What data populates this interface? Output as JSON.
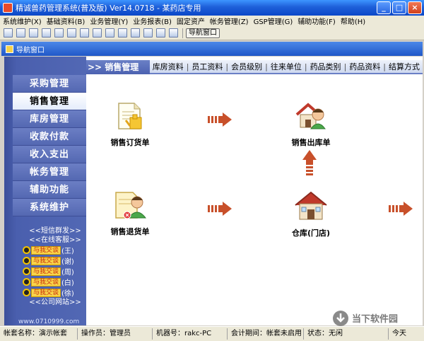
{
  "window": {
    "title": "精诚兽药管理系统(普及版) Ver14.0718 - 某药店专用"
  },
  "menu": [
    "系统维护(X)",
    "基础资料(B)",
    "业务管理(Y)",
    "业务报表(B)",
    "固定资产",
    "帐务管理(Z)",
    "GSP管理(G)",
    "辅助功能(F)",
    "帮助(H)"
  ],
  "toolbar": {
    "nav_window_label": "导航窗口"
  },
  "child_window": {
    "caption": "导航窗口"
  },
  "sidebar": {
    "items": [
      {
        "label": "采购管理"
      },
      {
        "label": "销售管理"
      },
      {
        "label": "库房管理"
      },
      {
        "label": "收款付款"
      },
      {
        "label": "收入支出"
      },
      {
        "label": "帐务管理"
      },
      {
        "label": "辅助功能"
      },
      {
        "label": "系统维护"
      }
    ],
    "sms_link": "<<短信群发>>",
    "service_link": "<<在线客服>>",
    "qq_button": "与我交谈",
    "qq_contacts": [
      "(王)",
      "(谢)",
      "(周)",
      "(白)",
      "(徐)"
    ],
    "company_link": "<<公司网站>>",
    "site": "www.0710999.com"
  },
  "content": {
    "header": ">> 销售管理",
    "tabs": [
      "库房资料",
      "员工资料",
      "会员级别",
      "往来单位",
      "药品类别",
      "药品资料",
      "结算方式"
    ],
    "nodes": {
      "sales_order": "销售订货单",
      "sales_outbound": "销售出库单",
      "sales_return": "销售退货单",
      "warehouse": "仓库(门店)"
    }
  },
  "status": {
    "account_name": "帐套名称：演示帐套",
    "operator": "操作员：管理员",
    "machine": "机器号：rakc-PC",
    "period": "会计期间：帐套未启用",
    "state": "状态：无闲",
    "today": "今天"
  },
  "watermark": "当下软件园"
}
